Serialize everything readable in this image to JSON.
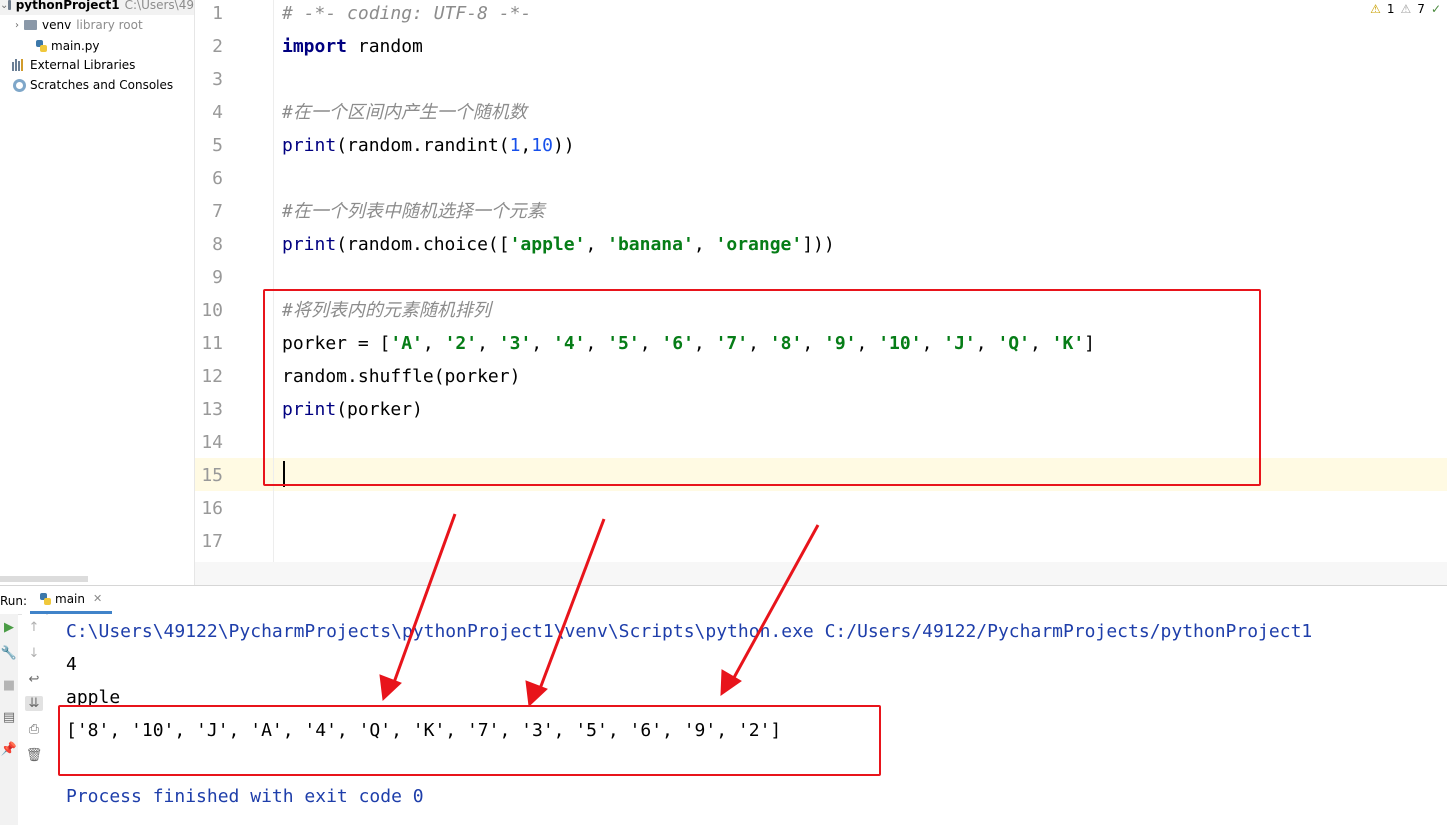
{
  "project": {
    "name": "pythonProject1",
    "path": "C:\\Users\\49",
    "items": [
      {
        "name": "venv",
        "note": "library root"
      },
      {
        "name": "main.py"
      },
      {
        "name": "External Libraries"
      },
      {
        "name": "Scratches and Consoles"
      }
    ]
  },
  "inspections": {
    "warnings": "1",
    "weak_warnings": "7",
    "ok_mark": "✓"
  },
  "editor": {
    "line_numbers": [
      "1",
      "2",
      "3",
      "4",
      "5",
      "6",
      "7",
      "8",
      "9",
      "10",
      "11",
      "12",
      "13",
      "14",
      "15",
      "16",
      "17"
    ],
    "current_line": 15,
    "code": {
      "l1": "# -*- coding: UTF-8 -*-",
      "l2_kw": "import",
      "l2_rest": " random",
      "l4": "#在一个区间内产生一个随机数",
      "l5_fn": "print",
      "l5_a": "(random.randint(",
      "l5_n1": "1",
      "l5_c": ",",
      "l5_n2": "10",
      "l5_b": "))",
      "l7": "#在一个列表中随机选择一个元素",
      "l8_fn": "print",
      "l8_a": "(random.choice([",
      "l8_s1": "'apple'",
      "l8_c1": ", ",
      "l8_s2": "'banana'",
      "l8_c2": ", ",
      "l8_s3": "'orange'",
      "l8_b": "]))",
      "l10": "#将列表内的元素随机排列",
      "l11_a": "porker = [",
      "l11_items": [
        "'A'",
        "'2'",
        "'3'",
        "'4'",
        "'5'",
        "'6'",
        "'7'",
        "'8'",
        "'9'",
        "'10'",
        "'J'",
        "'Q'",
        "'K'"
      ],
      "l11_sep": ", ",
      "l11_b": "]",
      "l12": "random.shuffle(porker)",
      "l13_fn": "print",
      "l13_rest": "(porker)"
    }
  },
  "run": {
    "label": "Run:",
    "tab": "main",
    "output": [
      "C:\\Users\\49122\\PycharmProjects\\pythonProject1\\venv\\Scripts\\python.exe C:/Users/49122/PycharmProjects/pythonProject1",
      "4",
      "apple",
      "['8', '10', 'J', 'A', '4', 'Q', 'K', '7', '3', '5', '6', '9', '2']",
      "",
      "Process finished with exit code 0"
    ]
  },
  "colors": {
    "annotation": "#e8141b",
    "keyword": "#000080",
    "string": "#067d17",
    "number": "#1750eb",
    "comment": "#8c8c8c"
  }
}
